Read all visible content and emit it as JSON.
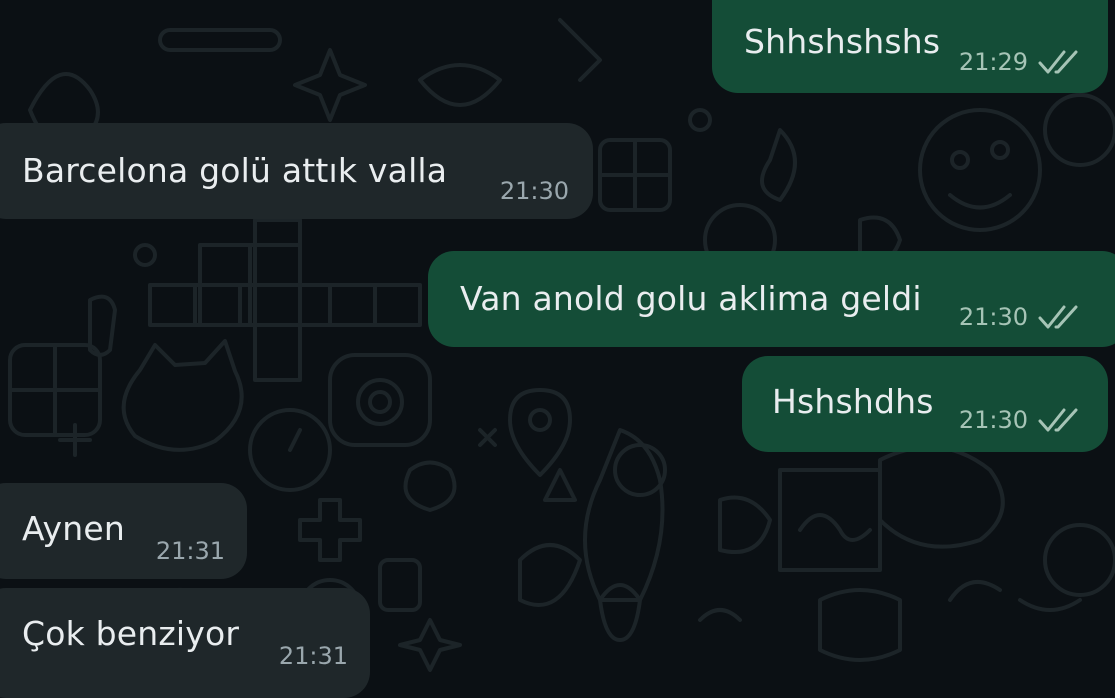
{
  "chat": {
    "messages": [
      {
        "direction": "outgoing",
        "text": "Shhshshshs",
        "time": "21:29",
        "status_icon": "double-check-read-icon"
      },
      {
        "direction": "incoming",
        "text": "Barcelona golü attık valla",
        "time": "21:30"
      },
      {
        "direction": "outgoing",
        "text": "Van anold golu aklima geldi",
        "time": "21:30",
        "status_icon": "double-check-read-icon"
      },
      {
        "direction": "outgoing",
        "text": "Hshshdhs",
        "time": "21:30",
        "status_icon": "double-check-read-icon"
      },
      {
        "direction": "incoming",
        "text": "Aynen",
        "time": "21:31"
      },
      {
        "direction": "incoming",
        "text": "Çok benziyor",
        "time": "21:31"
      }
    ]
  },
  "colors": {
    "background": "#0b1014",
    "outgoing_bubble": "#144d37",
    "incoming_bubble": "#1f272a",
    "message_text": "#e9edef",
    "timestamp": "#9aa7ad",
    "wallpaper_doodle": "#1c2428"
  }
}
